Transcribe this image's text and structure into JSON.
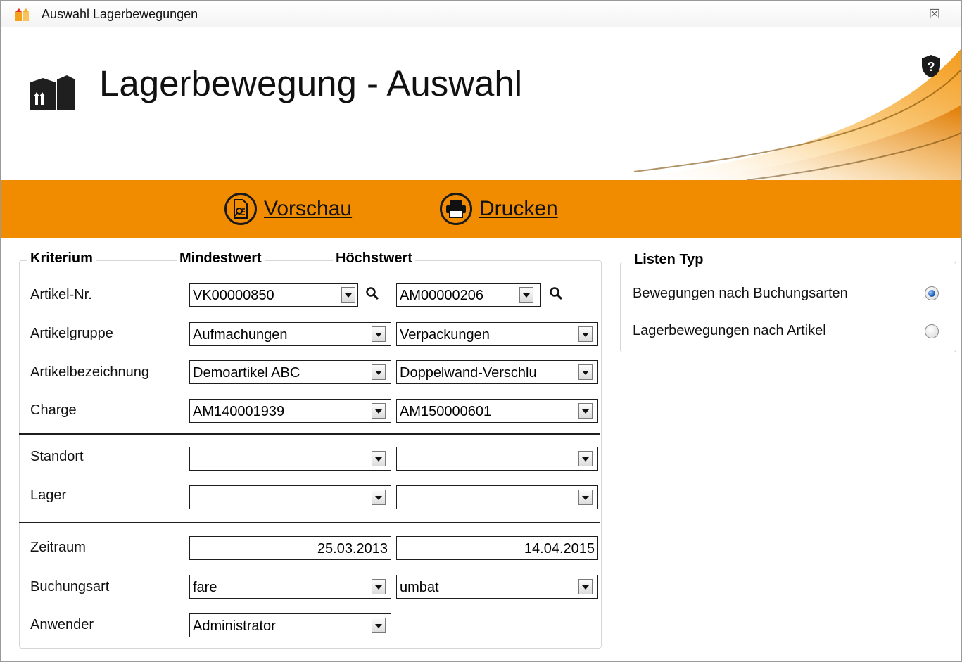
{
  "window": {
    "title": "Auswahl Lagerbewegungen",
    "close_glyph": "☒"
  },
  "header": {
    "title": "Lagerbewegung - Auswahl",
    "icon": "warehouse-icon",
    "help_icon": "help-shield-icon"
  },
  "toolbar": {
    "preview": {
      "label": "Vorschau",
      "icon": "preview-document-icon"
    },
    "print": {
      "label": "Drucken",
      "icon": "printer-icon"
    }
  },
  "criteria": {
    "headers": {
      "criterion": "Kriterium",
      "min": "Mindestwert",
      "max": "Höchstwert"
    },
    "rows": [
      {
        "label": "Artikel-Nr.",
        "min": "VK00000850",
        "max": "AM00000206"
      },
      {
        "label": "Artikelgruppe",
        "min": "Aufmachungen",
        "max": "Verpackungen"
      },
      {
        "label": "Artikelbezeichnung",
        "min": "Demoartikel ABC",
        "max": "Doppelwand-Verschlu"
      },
      {
        "label": "Charge",
        "min": "AM140001939",
        "max": "AM150000601"
      },
      {
        "label": "Standort",
        "min": "",
        "max": ""
      },
      {
        "label": "Lager",
        "min": "",
        "max": ""
      },
      {
        "label": "Zeitraum",
        "min": "25.03.2013",
        "max": "14.04.2015"
      },
      {
        "label": "Buchungsart",
        "min": "fare",
        "max": "umbat"
      },
      {
        "label": "Anwender",
        "min": "Administrator"
      }
    ]
  },
  "list_type": {
    "header": "Listen Typ",
    "options": [
      {
        "label": "Bewegungen nach Buchungsarten",
        "selected": true
      },
      {
        "label": "Lagerbewegungen nach Artikel",
        "selected": false
      }
    ]
  },
  "colors": {
    "accent": "#f18b00"
  }
}
